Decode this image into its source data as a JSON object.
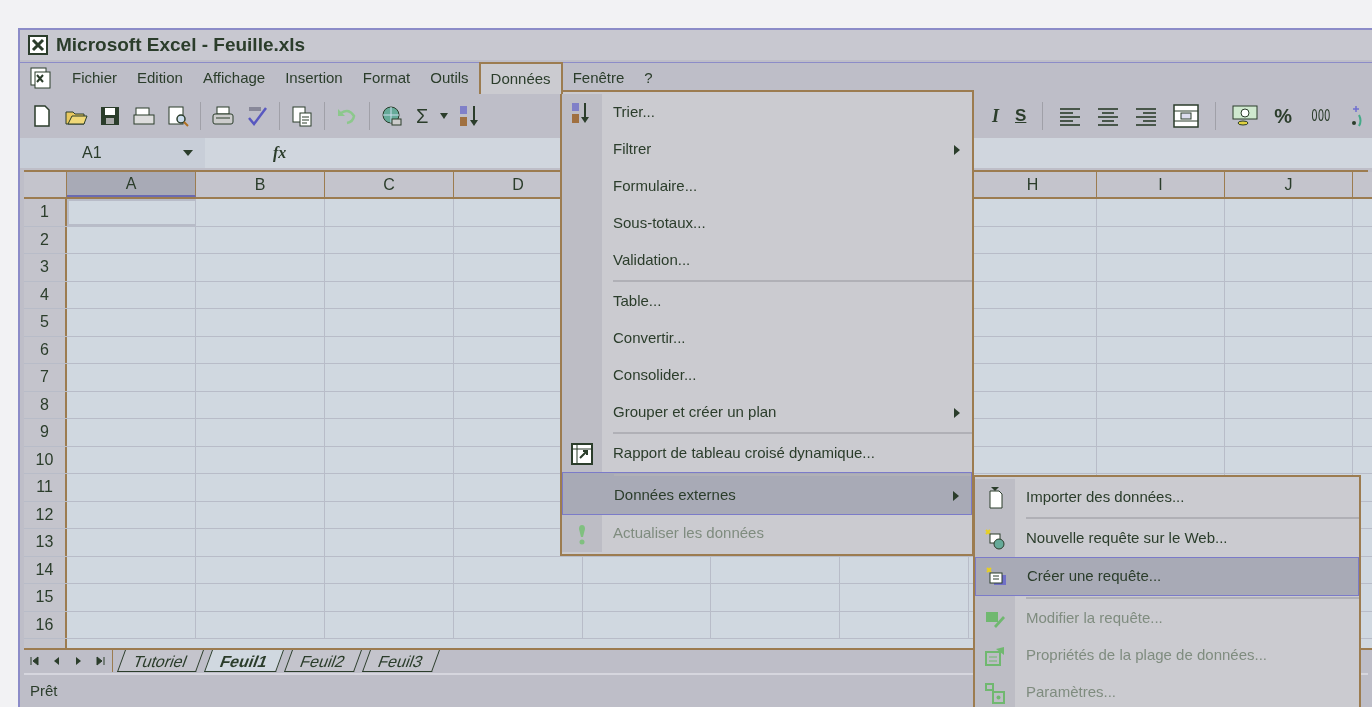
{
  "window": {
    "title": "Microsoft Excel - Feuille.xls"
  },
  "menu_bar": [
    {
      "label": "Fichier",
      "selected": false
    },
    {
      "label": "Edition",
      "selected": false
    },
    {
      "label": "Affichage",
      "selected": false
    },
    {
      "label": "Insertion",
      "selected": false
    },
    {
      "label": "Format",
      "selected": false
    },
    {
      "label": "Outils",
      "selected": false
    },
    {
      "label": "Données",
      "selected": true
    },
    {
      "label": "Fenêtre",
      "selected": false
    },
    {
      "label": "?",
      "selected": false
    }
  ],
  "toolbar": {
    "sum": "Σ",
    "italic": "I",
    "underline": "S",
    "percent": "%",
    "thousands": "000"
  },
  "formula_bar": {
    "name_box": "A1",
    "fx": "fx"
  },
  "columns_left": [
    {
      "label": "A",
      "selected": true
    },
    {
      "label": "B",
      "selected": false
    },
    {
      "label": "C",
      "selected": false
    },
    {
      "label": "D",
      "selected": false
    }
  ],
  "columns_right": [
    {
      "label": "H",
      "selected": false
    },
    {
      "label": "I",
      "selected": false
    },
    {
      "label": "J",
      "selected": false
    }
  ],
  "rows": [
    "1",
    "2",
    "3",
    "4",
    "5",
    "6",
    "7",
    "8",
    "9",
    "10",
    "11",
    "12",
    "13",
    "14",
    "15",
    "16"
  ],
  "sheet_tabs": [
    {
      "label": "Tutoriel",
      "selected": false
    },
    {
      "label": "Feuil1",
      "selected": true
    },
    {
      "label": "Feuil2",
      "selected": false
    },
    {
      "label": "Feuil3",
      "selected": false
    }
  ],
  "status_bar": "Prêt",
  "data_menu": [
    {
      "label": "Trier...",
      "submenu": false,
      "disabled": false,
      "selected": false,
      "separator_before": false
    },
    {
      "label": "Filtrer",
      "submenu": true,
      "disabled": false,
      "selected": false,
      "separator_before": false
    },
    {
      "label": "Formulaire...",
      "submenu": false,
      "disabled": false,
      "selected": false,
      "separator_before": false
    },
    {
      "label": "Sous-totaux...",
      "submenu": false,
      "disabled": false,
      "selected": false,
      "separator_before": false
    },
    {
      "label": "Validation...",
      "submenu": false,
      "disabled": false,
      "selected": false,
      "separator_before": false
    },
    {
      "label": "Table...",
      "submenu": false,
      "disabled": false,
      "selected": false,
      "separator_before": true
    },
    {
      "label": "Convertir...",
      "submenu": false,
      "disabled": false,
      "selected": false,
      "separator_before": false
    },
    {
      "label": "Consolider...",
      "submenu": false,
      "disabled": false,
      "selected": false,
      "separator_before": false
    },
    {
      "label": "Grouper et créer un plan",
      "submenu": true,
      "disabled": false,
      "selected": false,
      "separator_before": false
    },
    {
      "label": "Rapport de tableau croisé dynamique...",
      "submenu": false,
      "disabled": false,
      "selected": false,
      "separator_before": true
    },
    {
      "label": "Données externes",
      "submenu": true,
      "disabled": false,
      "selected": true,
      "separator_before": true
    },
    {
      "label": "Actualiser les données",
      "submenu": false,
      "disabled": true,
      "selected": false,
      "separator_before": false
    }
  ],
  "external_data_submenu": [
    {
      "label": "Importer des données...",
      "disabled": false,
      "selected": false,
      "separator_before": false
    },
    {
      "label": "Nouvelle requête sur le Web...",
      "disabled": false,
      "selected": false,
      "separator_before": true
    },
    {
      "label": "Créer une requête...",
      "disabled": false,
      "selected": true,
      "separator_before": false
    },
    {
      "label": "Modifier la requête...",
      "disabled": true,
      "selected": false,
      "separator_before": true
    },
    {
      "label": "Propriétés de la plage de données...",
      "disabled": true,
      "selected": false,
      "separator_before": false
    },
    {
      "label": "Paramètres...",
      "disabled": true,
      "selected": false,
      "separator_before": false
    }
  ]
}
